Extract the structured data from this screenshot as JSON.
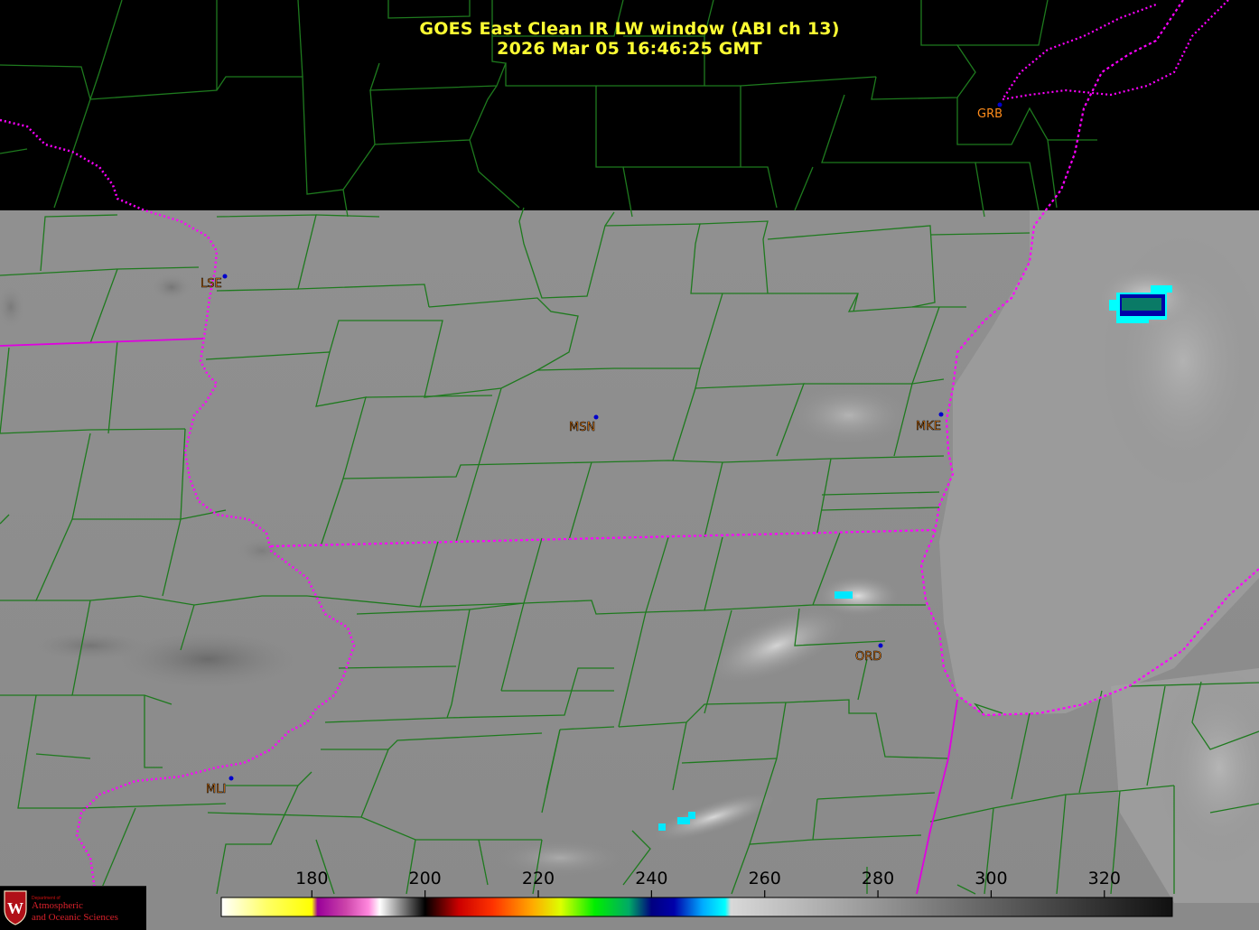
{
  "title": {
    "line1": "GOES East Clean IR LW window (ABI ch 13)",
    "line2": "2026 Mar 05  16:46:25 GMT"
  },
  "stations": [
    {
      "id": "GRB",
      "label": "GRB"
    },
    {
      "id": "LSE",
      "label": "LSE"
    },
    {
      "id": "MSN",
      "label": "MSN"
    },
    {
      "id": "MKE",
      "label": "MKE"
    },
    {
      "id": "ORD",
      "label": "ORD"
    },
    {
      "id": "MLI",
      "label": "MLI"
    }
  ],
  "colorbar": {
    "ticks": [
      "180",
      "200",
      "220",
      "240",
      "260",
      "280",
      "300",
      "320"
    ],
    "tick_values": [
      180,
      200,
      220,
      240,
      260,
      280,
      300,
      320
    ],
    "range": [
      164,
      332
    ],
    "stops": [
      {
        "value": 164,
        "color": "#ffffff"
      },
      {
        "value": 172,
        "color": "#ffff66"
      },
      {
        "value": 180,
        "color": "#ffff00"
      },
      {
        "value": 181,
        "color": "#990099"
      },
      {
        "value": 186,
        "color": "#cc44aa"
      },
      {
        "value": 190,
        "color": "#ff88dd"
      },
      {
        "value": 192,
        "color": "#ffffff"
      },
      {
        "value": 200,
        "color": "#000000"
      },
      {
        "value": 206,
        "color": "#cc0000"
      },
      {
        "value": 212,
        "color": "#ff3300"
      },
      {
        "value": 219,
        "color": "#ffaa00"
      },
      {
        "value": 224,
        "color": "#ddff00"
      },
      {
        "value": 230,
        "color": "#00ee00"
      },
      {
        "value": 236,
        "color": "#00aa66"
      },
      {
        "value": 240,
        "color": "#000080"
      },
      {
        "value": 244,
        "color": "#0000aa"
      },
      {
        "value": 249,
        "color": "#00aaff"
      },
      {
        "value": 253,
        "color": "#00ffff"
      },
      {
        "value": 254,
        "color": "#d8d8d8"
      },
      {
        "value": 332,
        "color": "#101010"
      }
    ]
  },
  "logo": {
    "line1": "Department of",
    "line2": "Atmospheric",
    "line3": "and Oceanic Sciences",
    "mark": "W"
  },
  "colors": {
    "title": "#ffff33",
    "county_lines": "#1e7a1e",
    "state_lines": "#e000e0",
    "station_dot": "#0000cc",
    "station_label": "#ff8c1a",
    "ir_field": "#8e8e8e"
  },
  "icons": {
    "logo": "uw-crest-icon",
    "station": "station-dot-icon"
  }
}
